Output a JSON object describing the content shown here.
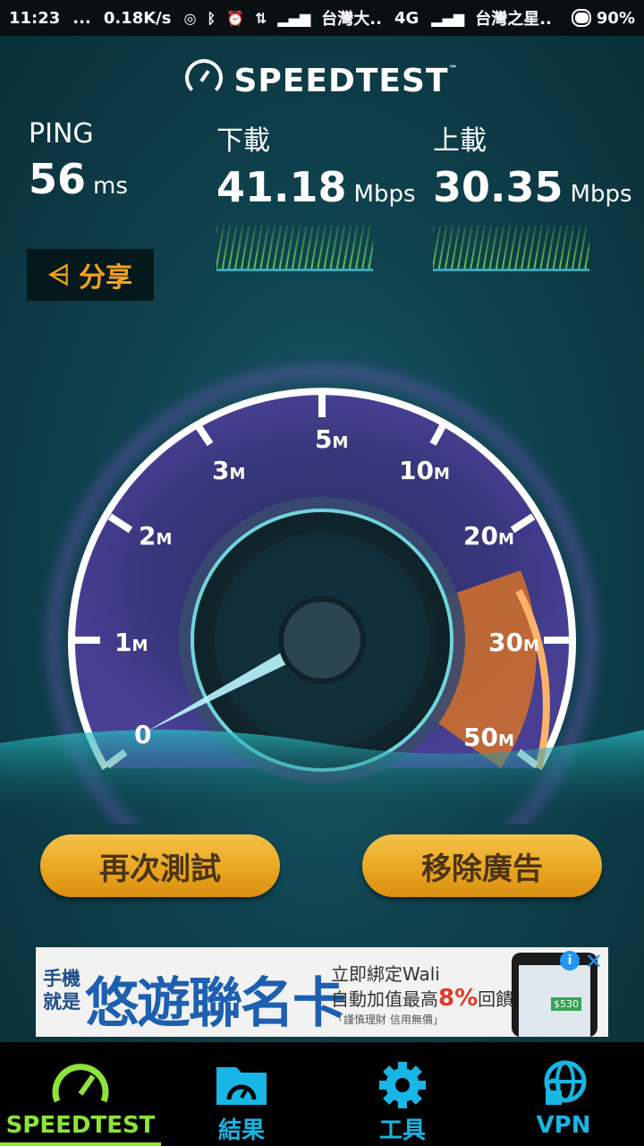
{
  "status_bar": {
    "time": "11:23",
    "dots": "...",
    "net_speed": "0.18K/s",
    "carrier1": "台灣大..",
    "network": "4G",
    "carrier2": "台灣之星..",
    "battery": "90%"
  },
  "header": {
    "logo_text": "SPEEDTEST",
    "trademark": "™"
  },
  "stats": {
    "ping": {
      "label": "PING",
      "value": "56",
      "unit": "ms"
    },
    "download": {
      "label": "下載",
      "value": "41.18",
      "unit": "Mbps"
    },
    "upload": {
      "label": "上載",
      "value": "30.35",
      "unit": "Mbps"
    }
  },
  "share": {
    "label": "分享"
  },
  "gauge": {
    "ticks": [
      {
        "num": "0",
        "unit": ""
      },
      {
        "num": "1",
        "unit": "M"
      },
      {
        "num": "2",
        "unit": "M"
      },
      {
        "num": "3",
        "unit": "M"
      },
      {
        "num": "5",
        "unit": "M"
      },
      {
        "num": "10",
        "unit": "M"
      },
      {
        "num": "20",
        "unit": "M"
      },
      {
        "num": "30",
        "unit": "M"
      },
      {
        "num": "50",
        "unit": "M"
      }
    ],
    "needle_fraction": 0.03
  },
  "actions": {
    "retest": "再次測試",
    "remove_ads": "移除廣告"
  },
  "ad": {
    "line1": "手機就是",
    "headline": "悠遊聯名卡",
    "sub1": "立即綁定Wali",
    "sub2_prefix": "自動加值最高",
    "sub2_pct": "8%",
    "sub2_suffix": "回饋",
    "note": "「謹慎理財 信用無價」",
    "phone_amount": "$530",
    "info": "i",
    "close": "✕"
  },
  "tabs": [
    {
      "label": "SPEEDTEST",
      "icon": "speedometer-icon",
      "active": true
    },
    {
      "label": "結果",
      "icon": "results-folder-icon",
      "active": false
    },
    {
      "label": "工具",
      "icon": "gear-icon",
      "active": false
    },
    {
      "label": "VPN",
      "icon": "vpn-globe-lock-icon",
      "active": false
    }
  ],
  "colors": {
    "accent_green": "#8de33a",
    "accent_blue": "#17b6e5",
    "button_gold": "#e8a41d",
    "share_orange": "#f3a21a",
    "gauge_orange": "#d5712a"
  }
}
